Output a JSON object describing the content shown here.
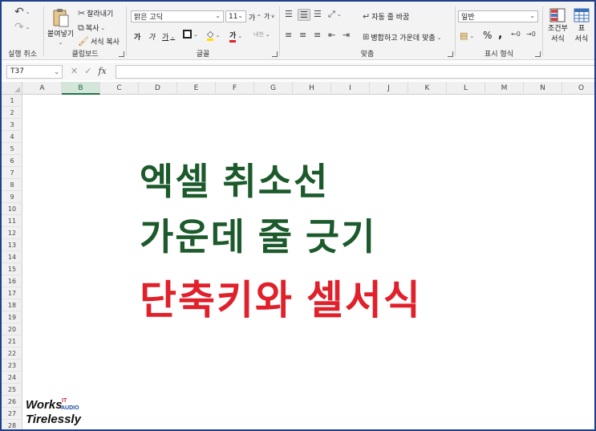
{
  "ribbon": {
    "undo": {
      "group_label": "실행 취소"
    },
    "clipboard": {
      "paste_label": "붙여넣기",
      "cut_label": "잘라내기",
      "copy_label": "복사",
      "format_painter_label": "서식 복사",
      "group_label": "클립보드"
    },
    "font": {
      "font_name": "맑은 고딕",
      "font_size": "11",
      "grow_font": "가",
      "shrink_font": "가",
      "bold": "가",
      "italic": "가",
      "underline": "가",
      "font_color_glyph": "가",
      "phonetic_glyph": "내천",
      "group_label": "글꼴"
    },
    "alignment": {
      "wrap_text_label": "자동 줄 바꿈",
      "merge_center_label": "병합하고 가운데 맞춤",
      "group_label": "맞춤"
    },
    "number": {
      "format_value": "일반",
      "percent": "%",
      "comma": ",",
      "group_label": "표시 형식"
    },
    "styles": {
      "conditional_label_1": "조건부",
      "conditional_label_2": "서식",
      "table_label_1": "표",
      "table_label_2": "서식"
    }
  },
  "formula_bar": {
    "name_box": "T37",
    "fx": "fx",
    "cancel": "✕",
    "enter": "✓",
    "formula_value": ""
  },
  "grid": {
    "columns": [
      "A",
      "B",
      "C",
      "D",
      "E",
      "F",
      "G",
      "H",
      "I",
      "J",
      "K",
      "L",
      "M",
      "N",
      "O"
    ],
    "active_column": "B",
    "rows": [
      "1",
      "2",
      "3",
      "4",
      "5",
      "6",
      "7",
      "8",
      "9",
      "10",
      "11",
      "12",
      "13",
      "14",
      "15",
      "16",
      "17",
      "18",
      "19",
      "20",
      "21",
      "22",
      "23",
      "24",
      "25",
      "26",
      "27",
      "28"
    ]
  },
  "overlay": {
    "line1": "엑셀 취소선",
    "line2": "가운데 줄 긋기",
    "line3": "단축키와 셀서식",
    "line1_color": "#1c5a2c",
    "line3_color": "#e0202a"
  },
  "watermark": {
    "works": "Works",
    "it": "IT",
    "audio": "AUDIO",
    "tirelessly": "Tirelessly"
  },
  "colors": {
    "excel_green": "#217346",
    "frame_border": "#1f3e8c"
  }
}
